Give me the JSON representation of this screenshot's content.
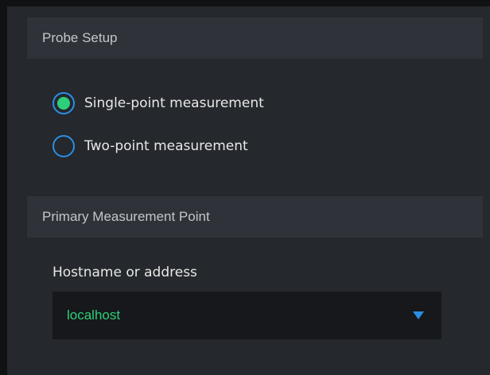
{
  "sections": {
    "probe_setup": {
      "title": "Probe Setup",
      "options": [
        {
          "label": "Single-point measurement",
          "selected": true
        },
        {
          "label": "Two-point measurement",
          "selected": false
        }
      ]
    },
    "primary_point": {
      "title": "Primary Measurement Point",
      "hostname_label": "Hostname or address",
      "hostname_value": "localhost"
    }
  },
  "colors": {
    "accent_blue": "#2a8ee6",
    "selected_green": "#2ecf7a",
    "value_green": "#2ecf7a"
  },
  "icons": {
    "dropdown": "chevron-down-icon"
  }
}
